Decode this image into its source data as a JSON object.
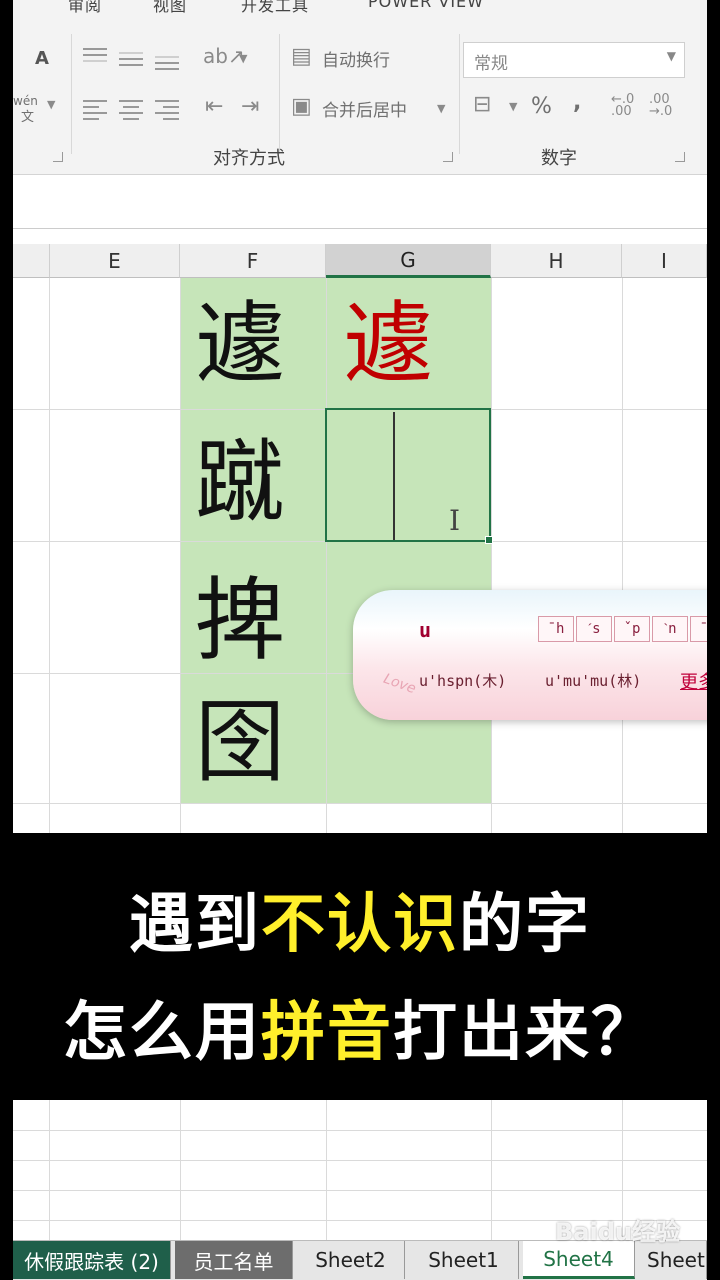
{
  "ribbon": {
    "tabs": [
      "审阅",
      "视图",
      "开发工具",
      "POWER VIEW"
    ],
    "wrap_text": "自动换行",
    "merge_center": "合并后居中",
    "alignment_label": "对齐方式",
    "number_format": "常规",
    "number_label": "数字",
    "percent": "%",
    "comma": ",",
    "wen": "wén",
    "wen_char": "文",
    "font_grow": "A"
  },
  "columns": [
    "E",
    "F",
    "G",
    "H",
    "I"
  ],
  "cells": {
    "f_chars": [
      "遽",
      "蹴",
      "捭",
      "囹"
    ],
    "g_char": "遽"
  },
  "ime": {
    "composition": "u",
    "tones": [
      "ˉh",
      "ˊs",
      "ˇp",
      "ˋn",
      "ˉz"
    ],
    "candidates": [
      "u'hspn(木)",
      "u'mu'mu(林)"
    ],
    "more": "更多",
    "love": "Love"
  },
  "caption": {
    "line1_pre": "遇到",
    "line1_hl": "不认识",
    "line1_post": "的字",
    "line2_pre": "怎么用",
    "line2_hl": "拼音",
    "line2_post": "打出来？"
  },
  "sheets": [
    "休假跟踪表 (2)",
    "员工名单",
    "Sheet2",
    "Sheet1",
    "Sheet4",
    "Sheet"
  ],
  "watermark": "Baidu经验"
}
